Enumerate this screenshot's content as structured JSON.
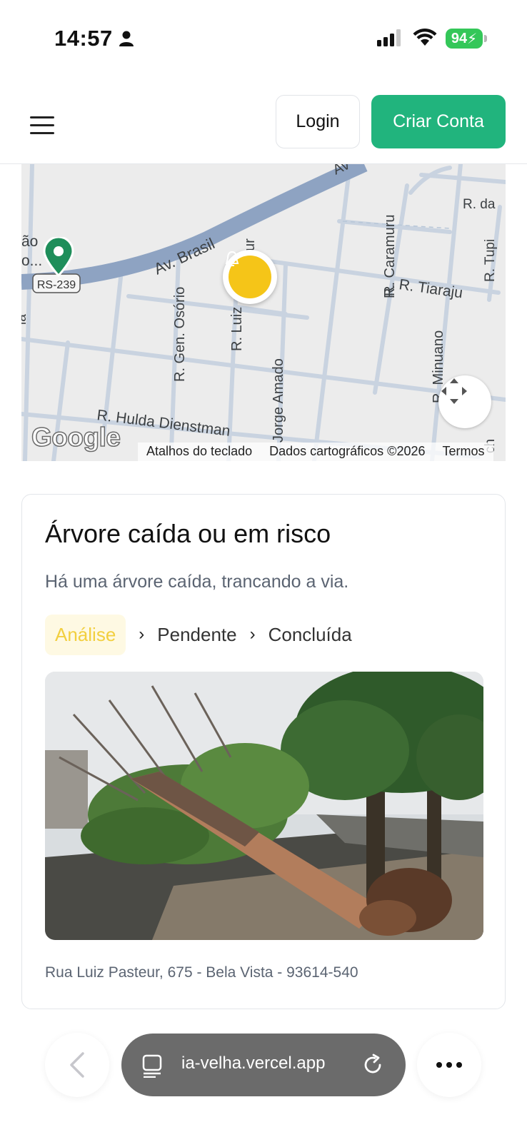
{
  "status_bar": {
    "time": "14:57",
    "battery": "94",
    "icons": [
      "person-icon",
      "signal-icon",
      "wifi-icon",
      "battery-icon"
    ]
  },
  "header": {
    "menu_icon": "hamburger-menu-icon",
    "login_label": "Login",
    "signup_label": "Criar Conta",
    "signup_color": "#21b47d"
  },
  "map": {
    "streets": {
      "avenue": "Av. Brasil",
      "avenue_short": "Av",
      "highway_badge": "RS-239",
      "gen_osorio": "R. Gen. Osório",
      "luiz": "R. Luiz",
      "luiz_tail": "ur",
      "jorge_amado": "Jorge Amado",
      "caramuru": "R. Caramuru",
      "tiaraju": "R. Tiaraju",
      "tiaraju_prefix": "R.",
      "minuano": "R. Minuano",
      "hulda": "R. Hulda Dienstman",
      "r_da": "R. da",
      "r_tupi": "R. Tupi",
      "poi_line1": "ão",
      "poi_line2": "o...",
      "edge_left": "ia",
      "edge_right": "ch"
    },
    "google_logo": "Google",
    "credits": {
      "shortcuts": "Atalhos do teclado",
      "data": "Dados cartográficos ©2026",
      "terms": "Termos"
    },
    "marker_color": "#f5c518",
    "pin_color": "#1e8e5a"
  },
  "report_card": {
    "title": "Árvore caída ou em risco",
    "description": "Há uma árvore caída, trancando a via.",
    "steps": [
      {
        "label": "Análise",
        "active": true
      },
      {
        "label": "Pendente",
        "active": false
      },
      {
        "label": "Concluída",
        "active": false
      }
    ],
    "separator": "›",
    "address": "Rua Luiz Pasteur, 675 - Bela Vista - 93614-540",
    "active_step_color": "#f2cf3f"
  },
  "browser_bar": {
    "url": "ia-velha.vercel.app",
    "icons": [
      "back-arrow-icon",
      "tabs-icon",
      "reload-icon",
      "more-icon"
    ]
  }
}
